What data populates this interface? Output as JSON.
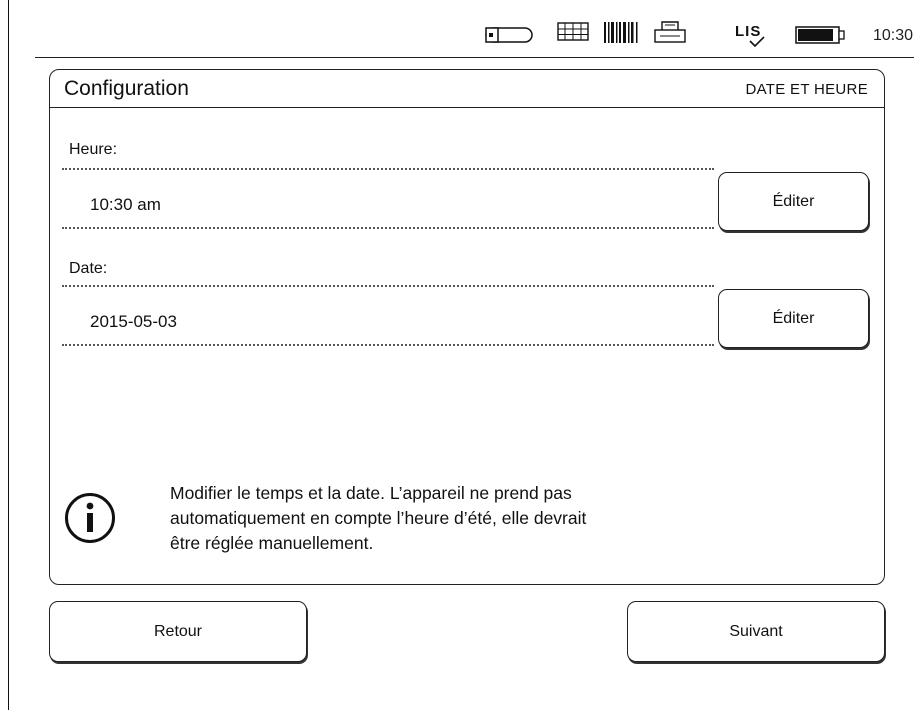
{
  "status_bar": {
    "time": "10:30",
    "lis_label": "LIS",
    "icons": [
      "usb-icon",
      "keyboard-icon",
      "barcode-icon",
      "printer-icon",
      "lis-icon",
      "battery-icon"
    ]
  },
  "header": {
    "title": "Configuration",
    "section": "DATE ET HEURE"
  },
  "fields": {
    "time": {
      "label": "Heure:",
      "value": "10:30 am",
      "edit_label": "Éditer"
    },
    "date": {
      "label": "Date:",
      "value": "2015-05-03",
      "edit_label": "Éditer"
    }
  },
  "info": {
    "icon": "info-icon",
    "line1": "Modifier le temps et la date. L’appareil ne prend pas",
    "line2": "automatiquement en compte l’heure d’été, elle devrait",
    "line3": "être réglée manuellement."
  },
  "nav": {
    "back_label": "Retour",
    "next_label": "Suivant"
  }
}
